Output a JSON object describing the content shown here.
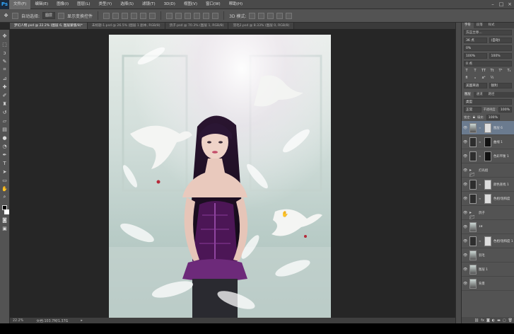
{
  "app": {
    "logo": "Ps"
  },
  "menubar": {
    "items": [
      "文件(F)",
      "编辑(E)",
      "图像(I)",
      "图层(L)",
      "类型(Y)",
      "选择(S)",
      "滤镜(T)",
      "3D(D)",
      "视图(V)",
      "窗口(W)",
      "帮助(H)"
    ],
    "active_index": 0,
    "window_controls": [
      "–",
      "□",
      "×"
    ]
  },
  "options": {
    "auto_select_label": "自动选择:",
    "auto_select_value": "图层",
    "show_transform_label": "显示变换控件",
    "mode_3d_label": "3D 模式:"
  },
  "tabs": [
    {
      "label": "梦幻人物.psd @ 22.2% (图层 6, 图层蒙版/8)*",
      "active": true
    },
    {
      "label": "未标题-1.psd @ 26.5% (图层 1 副本, RGB/8)",
      "active": false
    },
    {
      "label": "鸽子.psd @ 70.3% (图层 1, RGB/8)",
      "active": false
    },
    {
      "label": "羽毛2.psd @ 8.33% (图层 0, RGB/8)",
      "active": false
    }
  ],
  "toolbox": {
    "tools": [
      "move-tool",
      "marquee-tool",
      "lasso-tool",
      "quick-select-tool",
      "crop-tool",
      "eyedropper-tool",
      "healing-tool",
      "brush-tool",
      "stamp-tool",
      "history-brush-tool",
      "eraser-tool",
      "gradient-tool",
      "blur-tool",
      "dodge-tool",
      "pen-tool",
      "type-tool",
      "path-select-tool",
      "shape-tool",
      "hand-tool",
      "zoom-tool"
    ]
  },
  "status": {
    "zoom": "22.2%",
    "doc_label": "文档:103.7M/1.37G"
  },
  "panels": {
    "top_tabs": [
      "字符",
      "段落",
      "样式"
    ],
    "font_family": "方正兰亭...",
    "font_size": "36 点",
    "leading": "(自动)",
    "tracking": "0%",
    "scale_v": "100%",
    "scale_h": "100%",
    "baseline": "0 点",
    "language": "美国英语",
    "antialias": "锐利"
  },
  "layers": {
    "tabs": [
      "图层",
      "通道",
      "路径"
    ],
    "filter_label": "类型",
    "blend_mode": "正常",
    "opacity_label": "不透明度:",
    "opacity": "100%",
    "lock_label": "锁定:",
    "fill_label": "填充:",
    "fill": "100%",
    "items": [
      {
        "name": "图层 6",
        "thumb": "photo",
        "mask": true,
        "selected": true
      },
      {
        "name": "曲线 1",
        "thumb": "adj",
        "mask": true,
        "selected": false
      },
      {
        "name": "色彩平衡 1",
        "thumb": "adj",
        "mask": true,
        "selected": false
      },
      {
        "name": "灯光组",
        "thumb": "folder",
        "mask": false,
        "selected": false
      },
      {
        "name": "颜色查找 1",
        "thumb": "adj",
        "mask": true,
        "selected": false
      },
      {
        "name": "色相/饱和度",
        "thumb": "adj",
        "mask": true,
        "selected": false
      },
      {
        "name": "鸽子",
        "thumb": "folder",
        "mask": false,
        "selected": false
      },
      {
        "name": "18",
        "thumb": "photo",
        "mask": false,
        "selected": false
      },
      {
        "name": "色相/饱和度 1",
        "thumb": "adj",
        "mask": true,
        "selected": false
      },
      {
        "name": "羽毛",
        "thumb": "photo",
        "mask": false,
        "selected": false
      },
      {
        "name": "图层 1",
        "thumb": "photo",
        "mask": false,
        "selected": false
      },
      {
        "name": "背景",
        "thumb": "photo",
        "mask": false,
        "selected": false
      }
    ]
  }
}
